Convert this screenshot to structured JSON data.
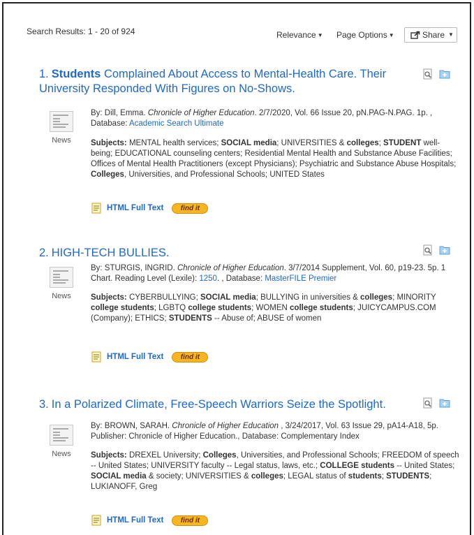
{
  "header": {
    "count": "Search Results: 1 - 20 of 924",
    "sort_label": "Relevance",
    "page_options_label": "Page Options",
    "share_label": "Share"
  },
  "results": [
    {
      "number": "1.",
      "title_parts": [
        {
          "text": "Students",
          "bold": true
        },
        {
          "text": " Complained About Access to Mental-Health Care. Their University Responded With Figures on No-Shows.",
          "bold": false
        }
      ],
      "pub_type": "News",
      "meta": [
        {
          "text": "By: Dill, Emma. "
        },
        {
          "text": "Chronicle of Higher Education",
          "style": "italic"
        },
        {
          "text": ". 2/7/2020, Vol. 66 Issue 20, pN.PAG-N.PAG. 1p. , Database: "
        },
        {
          "text": "Academic Search Ultimate",
          "style": "link"
        }
      ],
      "subjects": [
        {
          "text": "Subjects:",
          "bold": true
        },
        {
          "text": " MENTAL health services; "
        },
        {
          "text": "SOCIAL media",
          "bold": true
        },
        {
          "text": "; UNIVERSITIES & "
        },
        {
          "text": "colleges",
          "bold": true
        },
        {
          "text": "; "
        },
        {
          "text": "STUDENT",
          "bold": true
        },
        {
          "text": " well-being; EDUCATIONAL counseling centers; Residential Mental Health and Substance Abuse Facilities; Offices of Mental Health Practitioners (except Physicians); Psychiatric and Substance Abuse Hospitals; "
        },
        {
          "text": "Colleges",
          "bold": true
        },
        {
          "text": ", Universities, and Professional Schools; UNITED States"
        }
      ],
      "html_full_text": "HTML Full Text",
      "findit": "find it"
    },
    {
      "number": "2.",
      "title_parts": [
        {
          "text": "HIGH-TECH BULLIES.",
          "bold": false
        }
      ],
      "pub_type": "News",
      "meta": [
        {
          "text": "By: STURGIS, INGRID. "
        },
        {
          "text": "Chronicle of Higher Education",
          "style": "italic"
        },
        {
          "text": ". 3/7/2014 Supplement, Vol. 60, p19-23. 5p. 1 Chart. Reading Level (Lexile): "
        },
        {
          "text": "1250",
          "style": "link"
        },
        {
          "text": ". , Database: "
        },
        {
          "text": "MasterFILE Premier",
          "style": "link"
        }
      ],
      "subjects": [
        {
          "text": "Subjects:",
          "bold": true
        },
        {
          "text": " CYBERBULLYING; "
        },
        {
          "text": "SOCIAL media",
          "bold": true
        },
        {
          "text": "; BULLYING in universities & "
        },
        {
          "text": "colleges",
          "bold": true
        },
        {
          "text": "; MINORITY "
        },
        {
          "text": "college students",
          "bold": true
        },
        {
          "text": "; LGBTQ "
        },
        {
          "text": "college students",
          "bold": true
        },
        {
          "text": "; WOMEN "
        },
        {
          "text": "college students",
          "bold": true
        },
        {
          "text": "; JUICYCAMPUS.COM (Company); ETHICS; "
        },
        {
          "text": "STUDENTS",
          "bold": true
        },
        {
          "text": " -- Abuse of; ABUSE of women"
        }
      ],
      "html_full_text": "HTML Full Text",
      "findit": "find it"
    },
    {
      "number": "3.",
      "title_parts": [
        {
          "text": "In a Polarized Climate, Free-Speech Warriors Seize the Spotlight.",
          "bold": false
        }
      ],
      "pub_type": "News",
      "meta": [
        {
          "text": "By: BROWN, SARAH. "
        },
        {
          "text": "Chronicle of Higher Education",
          "style": "italic"
        },
        {
          "text": " , 3/24/2017, Vol. 63 Issue 29, pA14-A18, 5p. Publisher: Chronicle of Higher Education., Database: Complementary Index"
        }
      ],
      "subjects": [
        {
          "text": "Subjects:",
          "bold": true
        },
        {
          "text": " DREXEL University; "
        },
        {
          "text": "Colleges",
          "bold": true
        },
        {
          "text": ", Universities, and Professional Schools; FREEDOM of speech -- United States; UNIVERSITY faculty -- Legal status, laws, etc.; "
        },
        {
          "text": "COLLEGE students",
          "bold": true
        },
        {
          "text": " -- United States; "
        },
        {
          "text": "SOCIAL media",
          "bold": true
        },
        {
          "text": " & society; UNIVERSITIES & "
        },
        {
          "text": "colleges",
          "bold": true
        },
        {
          "text": "; LEGAL status of "
        },
        {
          "text": "students",
          "bold": true
        },
        {
          "text": "; "
        },
        {
          "text": "STUDENTS",
          "bold": true
        },
        {
          "text": "; LUKIANOFF, Greg"
        }
      ],
      "html_full_text": "HTML Full Text",
      "findit": "find it"
    }
  ]
}
